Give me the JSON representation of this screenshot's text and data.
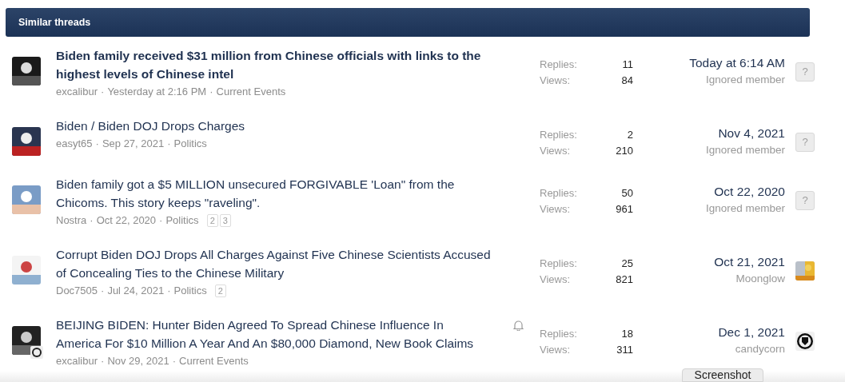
{
  "header": {
    "title": "Similar threads"
  },
  "threads": [
    {
      "title": "Biden family received $31 million from Chinese officials with links to the highest levels of Chinese intel",
      "unread": true,
      "watched": false,
      "author": "excalibur",
      "date": "Yesterday at 2:16 PM",
      "separator": "·",
      "forum": "Current Events",
      "replies_label": "Replies:",
      "replies": "11",
      "views_label": "Views:",
      "views": "84",
      "last_date": "Today at 6:14 AM",
      "last_user": "Ignored member",
      "last_avatar": {
        "kind": "unknown",
        "text": "?"
      },
      "avatar_badge": false
    },
    {
      "title": "Biden / Biden DOJ Drops Charges",
      "unread": false,
      "watched": false,
      "author": "easyt65",
      "date": "Sep 27, 2021",
      "separator": "·",
      "forum": "Politics",
      "replies_label": "Replies:",
      "replies": "2",
      "views_label": "Views:",
      "views": "210",
      "last_date": "Nov 4, 2021",
      "last_user": "Ignored member",
      "last_avatar": {
        "kind": "unknown",
        "text": "?"
      },
      "avatar_badge": false
    },
    {
      "title": "Biden family got a $5 MILLION unsecured FORGIVABLE 'Loan\" from the Chicoms. This story keeps \"raveling\".",
      "unread": false,
      "watched": false,
      "author": "Nostra",
      "date": "Oct 22, 2020",
      "separator": "·",
      "forum": "Politics",
      "pages": [
        "2",
        "3"
      ],
      "replies_label": "Replies:",
      "replies": "50",
      "views_label": "Views:",
      "views": "961",
      "last_date": "Oct 22, 2020",
      "last_user": "Ignored member",
      "last_avatar": {
        "kind": "unknown",
        "text": "?"
      },
      "avatar_badge": false
    },
    {
      "title": "Corrupt Biden DOJ Drops All Charges Against Five Chinese Scientists Accused of Concealing Ties to the Chinese Military",
      "unread": false,
      "watched": false,
      "author": "Doc7505",
      "date": "Jul 24, 2021",
      "separator": "·",
      "forum": "Politics",
      "pages": [
        "2"
      ],
      "replies_label": "Replies:",
      "replies": "25",
      "views_label": "Views:",
      "views": "821",
      "last_date": "Oct 21, 2021",
      "last_user": "Moonglow",
      "last_avatar": {
        "kind": "picture"
      },
      "avatar_badge": false
    },
    {
      "title": "BEIJING BIDEN: Hunter Biden Agreed To Spread Chinese Influence In America For $10 Million A Year And An $80,000 Diamond, New Book Claims",
      "unread": false,
      "watched": true,
      "author": "excalibur",
      "date": "Nov 29, 2021",
      "separator": "·",
      "forum": "Current Events",
      "replies_label": "Replies:",
      "replies": "18",
      "views_label": "Views:",
      "views": "311",
      "last_date": "Dec 1, 2021",
      "last_user": "candycorn",
      "last_avatar": {
        "kind": "emblem"
      },
      "avatar_badge": true
    }
  ],
  "tooltip": "Screenshot"
}
